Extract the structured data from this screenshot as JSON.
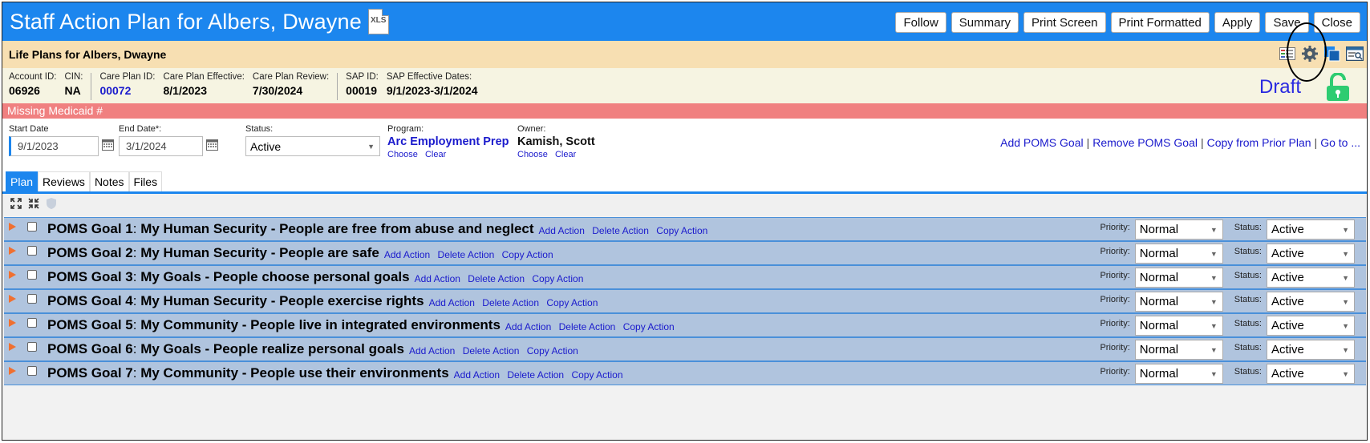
{
  "header": {
    "title": "Staff Action Plan for Albers, Dwayne",
    "xls_label": "XLS",
    "buttons": [
      "Follow",
      "Summary",
      "Print Screen",
      "Print Formatted",
      "Apply",
      "Save",
      "Close"
    ]
  },
  "lifebar": {
    "title": "Life Plans for Albers, Dwayne",
    "icons": [
      "grid-list-icon",
      "gear-icon",
      "copy-icon",
      "search-window-icon"
    ]
  },
  "info": {
    "account_id": {
      "label": "Account ID:",
      "value": "06926"
    },
    "cin": {
      "label": "CIN:",
      "value": "NA"
    },
    "care_plan_id": {
      "label": "Care Plan ID:",
      "value": "00072"
    },
    "care_plan_effective": {
      "label": "Care Plan Effective:",
      "value": "8/1/2023"
    },
    "care_plan_review": {
      "label": "Care Plan Review:",
      "value": "7/30/2024"
    },
    "sap_id": {
      "label": "SAP ID:",
      "value": "00019"
    },
    "sap_effective": {
      "label": "SAP Effective Dates:",
      "value": "9/1/2023-3/1/2024"
    },
    "status_text": "Draft"
  },
  "warning": "Missing Medicaid #",
  "form": {
    "start_date": {
      "label": "Start Date",
      "value": "9/1/2023"
    },
    "end_date": {
      "label": "End Date*:",
      "value": "3/1/2024"
    },
    "status": {
      "label": "Status:",
      "value": "Active"
    },
    "program": {
      "label": "Program:",
      "value": "Arc Employment Prep",
      "choose": "Choose",
      "clear": "Clear"
    },
    "owner": {
      "label": "Owner:",
      "value": "Kamish, Scott",
      "choose": "Choose",
      "clear": "Clear"
    },
    "links": [
      "Add POMS Goal",
      "Remove POMS Goal",
      "Copy from Prior Plan",
      "Go to ..."
    ]
  },
  "tabs": [
    "Plan",
    "Reviews",
    "Notes",
    "Files"
  ],
  "toolbar_icons": [
    "expand-icon",
    "collapse-icon",
    "shield-icon"
  ],
  "goal_labels": {
    "priority": "Priority:",
    "status": "Status:"
  },
  "goal_action_labels": [
    "Add Action",
    "Delete Action",
    "Copy Action"
  ],
  "goals": [
    {
      "num": "POMS Goal 1",
      "text": "My Human Security - People are free from abuse and neglect",
      "priority": "Normal",
      "status": "Active"
    },
    {
      "num": "POMS Goal 2",
      "text": "My Human Security - People are safe",
      "priority": "Normal",
      "status": "Active"
    },
    {
      "num": "POMS Goal 3",
      "text": "My Goals - People choose personal goals",
      "priority": "Normal",
      "status": "Active"
    },
    {
      "num": "POMS Goal 4",
      "text": "My Human Security - People exercise rights",
      "priority": "Normal",
      "status": "Active"
    },
    {
      "num": "POMS Goal 5",
      "text": "My Community - People live in integrated environments",
      "priority": "Normal",
      "status": "Active"
    },
    {
      "num": "POMS Goal 6",
      "text": "My Goals - People realize personal goals",
      "priority": "Normal",
      "status": "Active"
    },
    {
      "num": "POMS Goal 7",
      "text": "My Community - People use their environments",
      "priority": "Normal",
      "status": "Active"
    }
  ]
}
